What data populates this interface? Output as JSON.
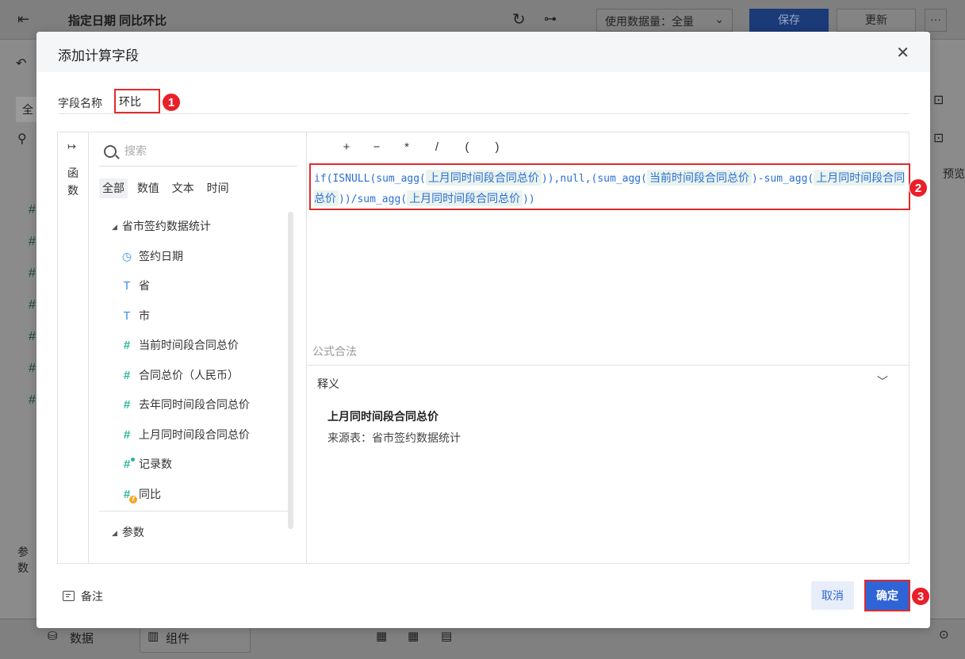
{
  "background": {
    "title": "指定日期 同比环比",
    "data_volume": "使用数据量：全量",
    "save_label": "保存",
    "update_label": "更新",
    "more_label": "···",
    "preview_label": "预览",
    "params_label": "参数",
    "bottom_data_label": "数据",
    "bottom_component_label": "组件",
    "left_tab_label": "全"
  },
  "dialog": {
    "title": "添加计算字段",
    "field_name_label": "字段名称",
    "field_name_value": "环比",
    "functions_label": "函数",
    "search_placeholder": "搜索",
    "tabs": [
      "全部",
      "数值",
      "文本",
      "时间"
    ],
    "dataset_name": "省市签约数据统计",
    "fields": [
      {
        "icon": "clock-icon",
        "label": "签约日期"
      },
      {
        "icon": "text-type-icon",
        "label": "省"
      },
      {
        "icon": "text-type-icon",
        "label": "市"
      },
      {
        "icon": "number-type-icon",
        "label": "当前时间段合同总价"
      },
      {
        "icon": "number-type-icon",
        "label": "合同总价（人民币）"
      },
      {
        "icon": "number-type-icon",
        "label": "去年同时间段合同总价"
      },
      {
        "icon": "number-type-icon",
        "label": "上月同时间段合同总价"
      },
      {
        "icon": "record-count-icon",
        "label": "记录数"
      },
      {
        "icon": "calculated-field-icon",
        "label": "同比"
      }
    ],
    "params_label": "参数",
    "operators": [
      "+",
      "−",
      "*",
      "/",
      "(",
      ")"
    ],
    "formula": {
      "t1": "if(ISNULL(sum_agg(",
      "f1": "上月同时间段合同总价",
      "t2": ")),null,(sum_agg(",
      "f2": "当前时间段合同总价",
      "t3": ")-sum_agg(",
      "f3": "上月同时间段合同总价",
      "t4": "))/sum_agg(",
      "f4": "上月同时间段合同总价",
      "t5": "))"
    },
    "formula_status": "公式合法",
    "explain_title": "释义",
    "explain_field": "上月同时间段合同总价",
    "explain_source": "来源表：省市签约数据统计",
    "note_label": "备注",
    "cancel_label": "取消",
    "confirm_label": "确定",
    "annotations": [
      "1",
      "2",
      "3"
    ],
    "accent_color": "#2f64d6",
    "highlight_color": "#e22b2b"
  }
}
